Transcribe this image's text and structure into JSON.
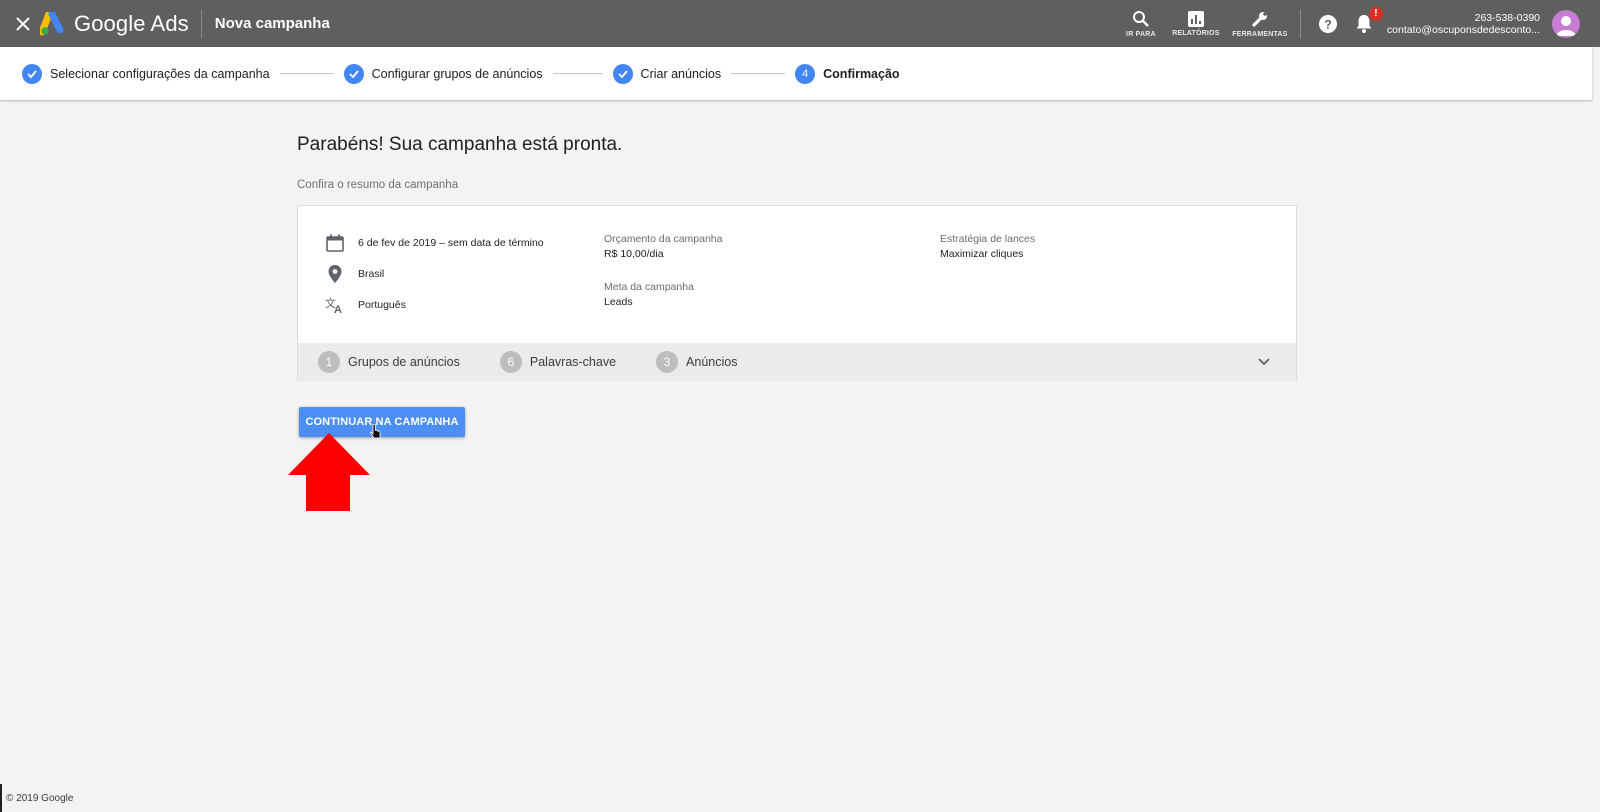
{
  "topbar": {
    "close_icon": "close-icon",
    "logo_text": "Google Ads",
    "title": "Nova campanha",
    "tools": [
      {
        "label": "IR PARA",
        "icon": "search-icon"
      },
      {
        "label": "RELATÓRIOS",
        "icon": "bar-chart-icon"
      },
      {
        "label": "FERRAMENTAS",
        "icon": "wrench-icon"
      }
    ],
    "notification_badge": "!",
    "account_id": "263-538-0390",
    "account_email": "contato@oscuponsdedesconto..."
  },
  "stepper": {
    "steps": [
      {
        "label": "Selecionar configurações da campanha",
        "state": "done"
      },
      {
        "label": "Configurar grupos de anúncios",
        "state": "done"
      },
      {
        "label": "Criar anúncios",
        "state": "done"
      },
      {
        "label": "Confirmação",
        "state": "active",
        "number": "4"
      }
    ]
  },
  "main": {
    "headline": "Parabéns! Sua campanha está pronta.",
    "subhead": "Confira o resumo da campanha",
    "summary": {
      "date": "6 de fev de 2019 – sem data de término",
      "location": "Brasil",
      "language": "Português",
      "budget_label": "Orçamento da campanha",
      "budget_value": "R$ 10,00/dia",
      "goal_label": "Meta da campanha",
      "goal_value": "Leads",
      "bidding_label": "Estratégia de lances",
      "bidding_value": "Maximizar cliques"
    },
    "counts": [
      {
        "num": "1",
        "label": "Grupos de anúncios"
      },
      {
        "num": "6",
        "label": "Palavras-chave"
      },
      {
        "num": "3",
        "label": "Anúncios"
      }
    ],
    "continue_button": "CONTINUAR NA CAMPANHA"
  },
  "footer": {
    "copyright": "© 2019 Google"
  },
  "colors": {
    "topbar": "#5f5f5f",
    "accent": "#4285f4",
    "button": "#4d8ef5",
    "annotation_arrow": "#ff0000"
  }
}
